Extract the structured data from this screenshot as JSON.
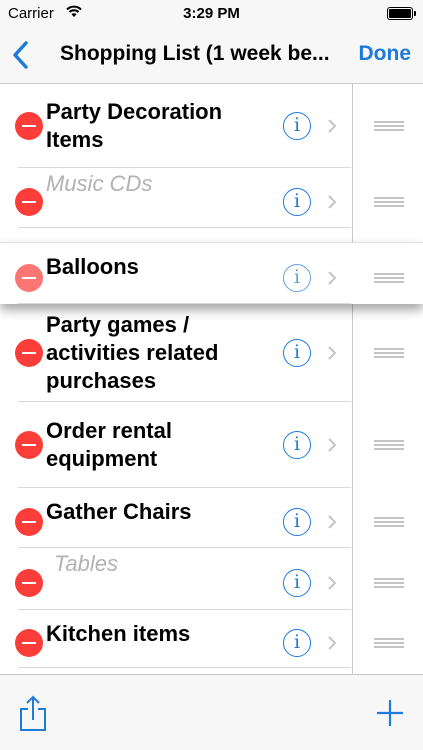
{
  "status_bar": {
    "carrier": "Carrier",
    "time": "3:29 PM",
    "icons": [
      "wifi-icon",
      "battery-icon"
    ]
  },
  "nav": {
    "title": "Shopping List (1 week be...",
    "done_label": "Done",
    "back_icon": "chevron-left-icon"
  },
  "colors": {
    "accent": "#1f7bd8",
    "delete": "#fc3d39",
    "muted_text": "#b1b1b6",
    "separator": "#c8c7cc"
  },
  "items": [
    {
      "line1": "Party Decoration",
      "line2": "Items",
      "line3": "",
      "muted": false
    },
    {
      "line1": "Music CDs",
      "line2": "",
      "line3": "",
      "muted": true
    },
    {
      "line1": "Balloons",
      "line2": "",
      "line3": "",
      "muted": false,
      "dragging": true
    },
    {
      "line1": "Party games /",
      "line2": "activities related",
      "line3": "purchases",
      "muted": false
    },
    {
      "line1": "Order rental",
      "line2": "equipment",
      "line3": "",
      "muted": false
    },
    {
      "line1": "Gather Chairs",
      "line2": "",
      "line3": "",
      "muted": false
    },
    {
      "line1": "Tables",
      "line2": "",
      "line3": "",
      "muted": true
    },
    {
      "line1": "Kitchen items",
      "line2": "",
      "line3": "",
      "muted": false
    }
  ],
  "info_glyph": "i",
  "toolbar": {
    "share_icon": "share-icon",
    "add_icon": "plus-icon"
  }
}
